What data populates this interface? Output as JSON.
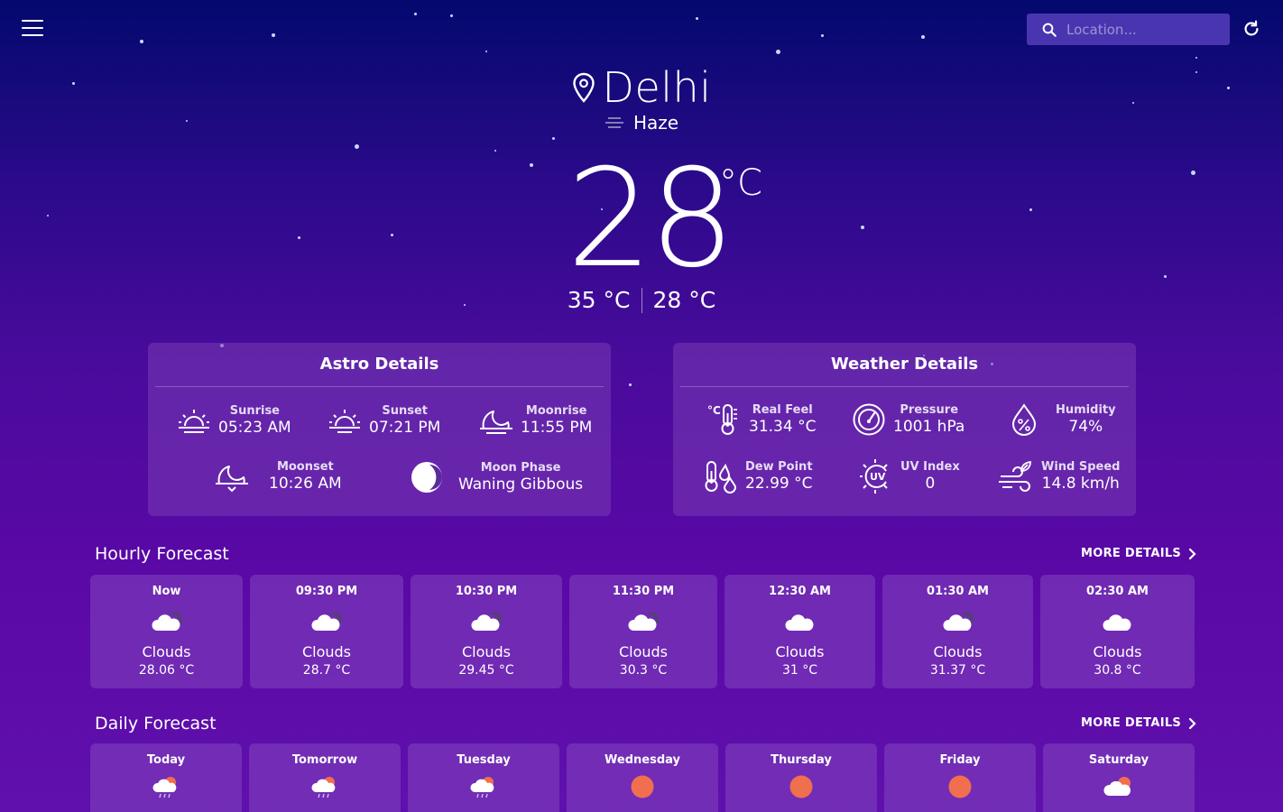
{
  "header": {
    "search_placeholder": "Location..."
  },
  "hero": {
    "city": "Delhi",
    "condition": "Haze",
    "temperature": "28",
    "unit": "°C",
    "temp_max": "35 °C",
    "temp_min": "28 °C"
  },
  "astro": {
    "title": "Astro Details",
    "items": [
      {
        "label": "Sunrise",
        "value": "05:23 AM",
        "icon": "sunrise-icon"
      },
      {
        "label": "Sunset",
        "value": "07:21 PM",
        "icon": "sunset-icon"
      },
      {
        "label": "Moonrise",
        "value": "11:55 PM",
        "icon": "moonrise-icon"
      },
      {
        "label": "Moonset",
        "value": "10:26 AM",
        "icon": "moonset-icon"
      },
      {
        "label": "Moon Phase",
        "value": "Waning Gibbous",
        "icon": "moon-phase-icon"
      }
    ]
  },
  "weather": {
    "title": "Weather Details",
    "items": [
      {
        "label": "Real Feel",
        "value": "31.34 °C",
        "icon": "thermometer-icon"
      },
      {
        "label": "Pressure",
        "value": "1001 hPa",
        "icon": "gauge-icon"
      },
      {
        "label": "Humidity",
        "value": "74%",
        "icon": "humidity-icon"
      },
      {
        "label": "Dew Point",
        "value": "22.99 °C",
        "icon": "dew-point-icon"
      },
      {
        "label": "UV Index",
        "value": "0",
        "icon": "uv-icon"
      },
      {
        "label": "Wind Speed",
        "value": "14.8 km/h",
        "icon": "wind-icon"
      }
    ]
  },
  "hourly": {
    "title": "Hourly Forecast",
    "more": "MORE DETAILS",
    "items": [
      {
        "time": "Now",
        "desc": "Clouds",
        "temp": "28.06 °C",
        "icon": "cloudy-night-icon"
      },
      {
        "time": "09:30 PM",
        "desc": "Clouds",
        "temp": "28.7 °C",
        "icon": "cloudy-night-icon"
      },
      {
        "time": "10:30 PM",
        "desc": "Clouds",
        "temp": "29.45 °C",
        "icon": "cloudy-night-icon"
      },
      {
        "time": "11:30 PM",
        "desc": "Clouds",
        "temp": "30.3 °C",
        "icon": "cloudy-night-icon"
      },
      {
        "time": "12:30 AM",
        "desc": "Clouds",
        "temp": "31 °C",
        "icon": "cloud-icon"
      },
      {
        "time": "01:30 AM",
        "desc": "Clouds",
        "temp": "31.37 °C",
        "icon": "cloudy-night-icon"
      },
      {
        "time": "02:30 AM",
        "desc": "Clouds",
        "temp": "30.8 °C",
        "icon": "cloud-icon"
      }
    ]
  },
  "daily": {
    "title": "Daily Forecast",
    "more": "MORE DETAILS",
    "items": [
      {
        "day": "Today",
        "icon": "rain-sun-icon"
      },
      {
        "day": "Tomorrow",
        "icon": "rain-sun-icon"
      },
      {
        "day": "Tuesday",
        "icon": "rain-sun-icon"
      },
      {
        "day": "Wednesday",
        "icon": "sun-icon"
      },
      {
        "day": "Thursday",
        "icon": "sun-icon"
      },
      {
        "day": "Friday",
        "icon": "sun-icon"
      },
      {
        "day": "Saturday",
        "icon": "partly-cloudy-icon"
      }
    ]
  },
  "colors": {
    "sun": "#f06f4f",
    "cloud": "#ffffff",
    "moon_cloud": "#4a4a5a",
    "search_bg": "#4a35b0"
  }
}
